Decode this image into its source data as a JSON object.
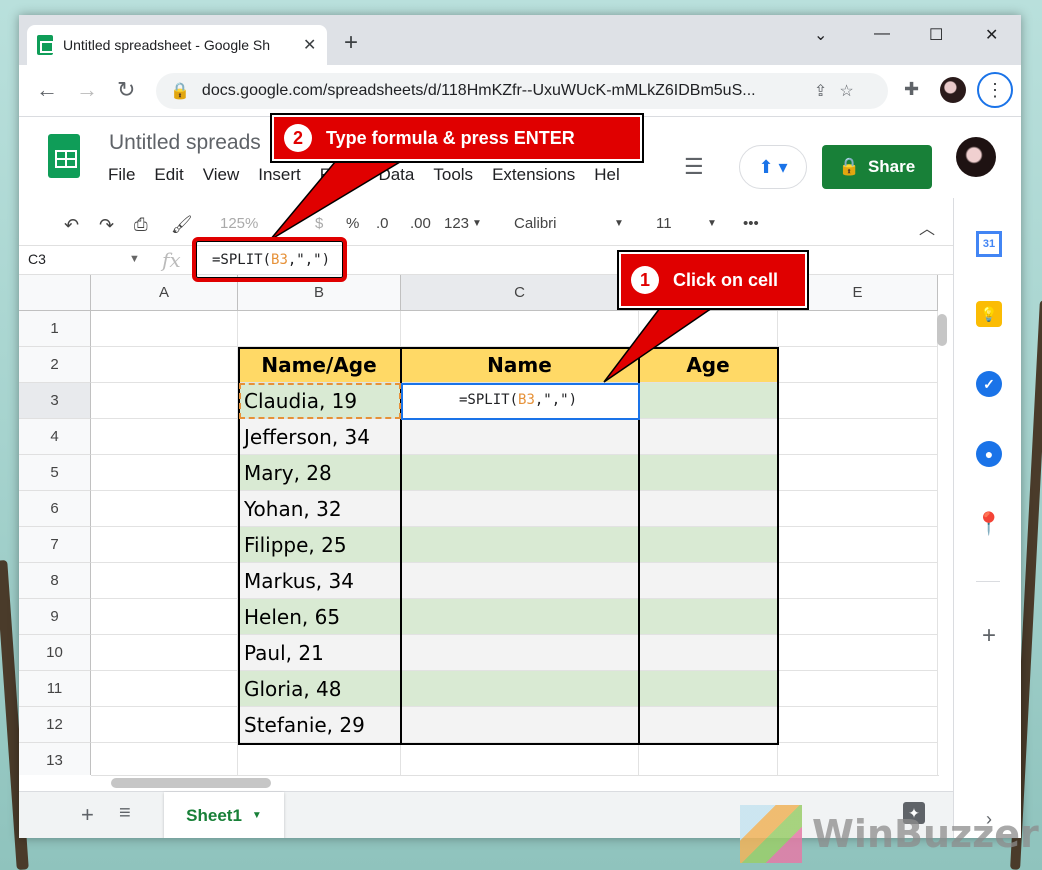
{
  "browser": {
    "tab_title": "Untitled spreadsheet - Google Sh",
    "url": "docs.google.com/spreadsheets/d/118HmKZfr--UxuWUcK-mMLkZ6IDBm5uS..."
  },
  "doc": {
    "title": "Untitled spreads",
    "menu": [
      "File",
      "Edit",
      "View",
      "Insert",
      "Form",
      "Data",
      "Tools",
      "Extensions",
      "Hel"
    ],
    "share_label": "Share"
  },
  "toolbar": {
    "zoom": "125%",
    "currency": "$",
    "percent": "%",
    "dec_decrease": ".0",
    "dec_increase": ".00",
    "format": "123",
    "font": "Calibri",
    "font_size": "11",
    "more": "•••"
  },
  "formula_bar": {
    "cell_ref": "C3",
    "fx": "fx",
    "formula_prefix": "=SPLIT(",
    "formula_ref": "B3",
    "formula_suffix": ",\",\")"
  },
  "grid": {
    "columns": [
      "A",
      "B",
      "C",
      "D",
      "E"
    ],
    "rows": [
      "1",
      "2",
      "3",
      "4",
      "5",
      "6",
      "7",
      "8",
      "9",
      "10",
      "11",
      "12",
      "13"
    ],
    "headers": {
      "b": "Name/Age",
      "c": "Name",
      "d": "Age"
    },
    "names": [
      "Claudia, 19",
      "Jefferson, 34",
      "Mary, 28",
      "Yohan, 32",
      "Filippe, 25",
      "Markus, 34",
      "Helen, 65",
      "Paul, 21",
      "Gloria, 48",
      "Stefanie, 29"
    ],
    "active_cell_formula_prefix": "=SPLIT(",
    "active_cell_formula_ref": "B3",
    "active_cell_formula_suffix": ",\",\")"
  },
  "sheets": {
    "active_tab": "Sheet1"
  },
  "side_panel": {
    "calendar_day": "31"
  },
  "annotations": {
    "step1_number": "1",
    "step1_text": "Click on cell",
    "step2_number": "2",
    "step2_text": "Type formula & press ENTER"
  },
  "watermark": "WinBuzzer",
  "colors": {
    "header_fill": "#ffd966",
    "green_fill": "#d9ead3",
    "gray_fill": "#f3f3f3",
    "callout_red": "#e00000",
    "share_green": "#188038",
    "selection_blue": "#1a73e8"
  }
}
